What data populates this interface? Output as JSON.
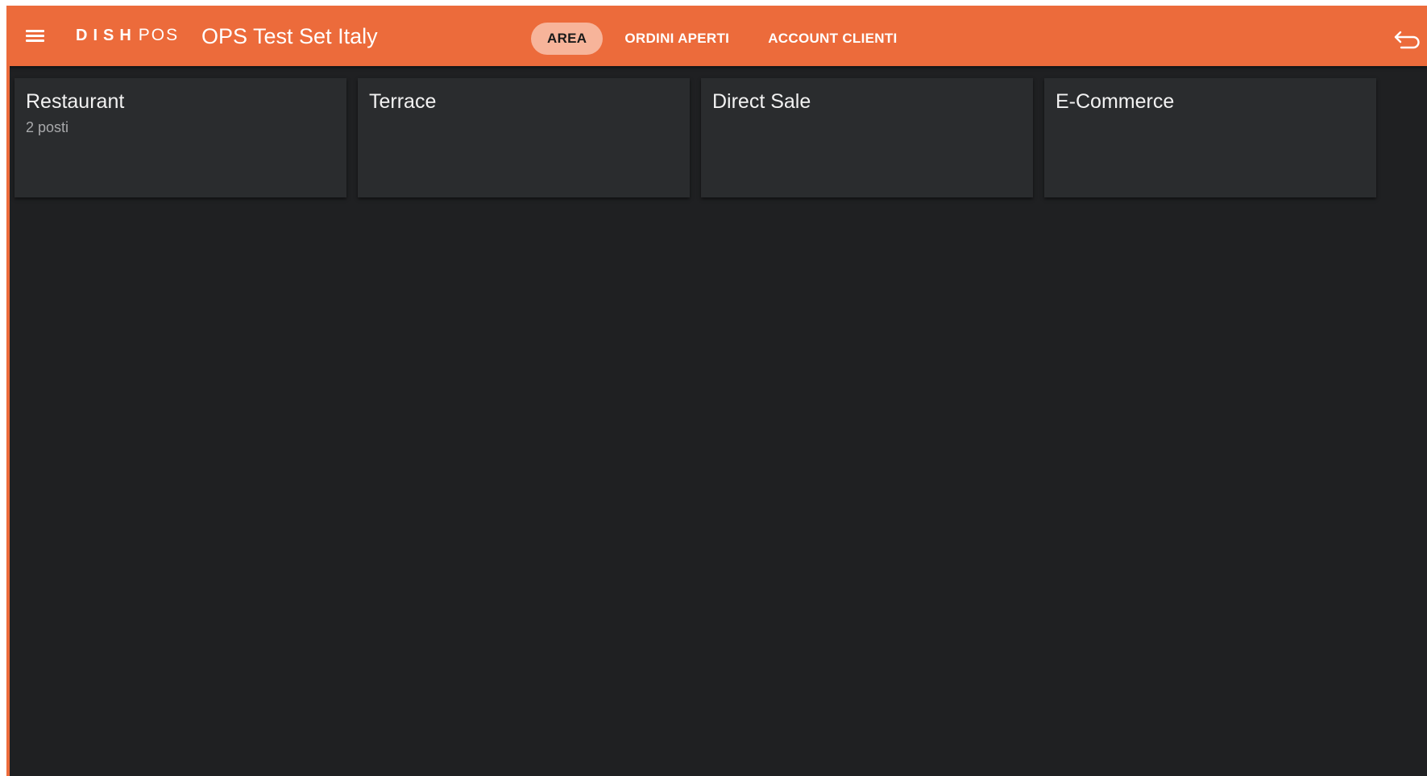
{
  "header": {
    "logo_primary": "DISH",
    "logo_secondary": "POS",
    "store_name": "OPS Test Set Italy",
    "accent_color": "#ec6b3b"
  },
  "tabs": [
    {
      "label": "AREA",
      "active": true
    },
    {
      "label": "ORDINI APERTI",
      "active": false
    },
    {
      "label": "ACCOUNT CLIENTI",
      "active": false
    }
  ],
  "areas": [
    {
      "name": "Restaurant",
      "subtitle": "2 posti"
    },
    {
      "name": "Terrace",
      "subtitle": ""
    },
    {
      "name": "Direct Sale",
      "subtitle": ""
    },
    {
      "name": "E-Commerce",
      "subtitle": ""
    }
  ],
  "icons": {
    "menu": "hamburger-menu-icon",
    "back": "back-arrow-icon"
  }
}
